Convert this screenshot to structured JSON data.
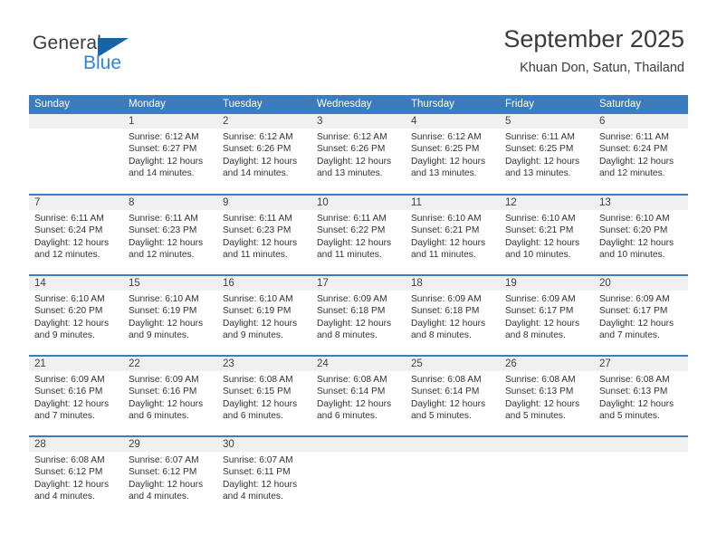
{
  "brand": {
    "name_top": "General",
    "name_bottom": "Blue",
    "accent_color": "#1565a8",
    "blue_text_color": "#2f86d8"
  },
  "header": {
    "title": "September 2025",
    "subtitle": "Khuan Don, Satun, Thailand"
  },
  "theme": {
    "header_row_bg": "#3a7cbe",
    "daynum_bg": "#f0f0f0",
    "text_color": "#333333"
  },
  "weekdays": [
    "Sunday",
    "Monday",
    "Tuesday",
    "Wednesday",
    "Thursday",
    "Friday",
    "Saturday"
  ],
  "labels": {
    "sunrise_prefix": "Sunrise: ",
    "sunset_prefix": "Sunset: ",
    "daylight_prefix": "Daylight: "
  },
  "weeks": [
    [
      {
        "day": "",
        "sunrise": "",
        "sunset": "",
        "daylight_line1": "",
        "daylight_line2": ""
      },
      {
        "day": "1",
        "sunrise": "Sunrise: 6:12 AM",
        "sunset": "Sunset: 6:27 PM",
        "daylight_line1": "Daylight: 12 hours",
        "daylight_line2": "and 14 minutes."
      },
      {
        "day": "2",
        "sunrise": "Sunrise: 6:12 AM",
        "sunset": "Sunset: 6:26 PM",
        "daylight_line1": "Daylight: 12 hours",
        "daylight_line2": "and 14 minutes."
      },
      {
        "day": "3",
        "sunrise": "Sunrise: 6:12 AM",
        "sunset": "Sunset: 6:26 PM",
        "daylight_line1": "Daylight: 12 hours",
        "daylight_line2": "and 13 minutes."
      },
      {
        "day": "4",
        "sunrise": "Sunrise: 6:12 AM",
        "sunset": "Sunset: 6:25 PM",
        "daylight_line1": "Daylight: 12 hours",
        "daylight_line2": "and 13 minutes."
      },
      {
        "day": "5",
        "sunrise": "Sunrise: 6:11 AM",
        "sunset": "Sunset: 6:25 PM",
        "daylight_line1": "Daylight: 12 hours",
        "daylight_line2": "and 13 minutes."
      },
      {
        "day": "6",
        "sunrise": "Sunrise: 6:11 AM",
        "sunset": "Sunset: 6:24 PM",
        "daylight_line1": "Daylight: 12 hours",
        "daylight_line2": "and 12 minutes."
      }
    ],
    [
      {
        "day": "7",
        "sunrise": "Sunrise: 6:11 AM",
        "sunset": "Sunset: 6:24 PM",
        "daylight_line1": "Daylight: 12 hours",
        "daylight_line2": "and 12 minutes."
      },
      {
        "day": "8",
        "sunrise": "Sunrise: 6:11 AM",
        "sunset": "Sunset: 6:23 PM",
        "daylight_line1": "Daylight: 12 hours",
        "daylight_line2": "and 12 minutes."
      },
      {
        "day": "9",
        "sunrise": "Sunrise: 6:11 AM",
        "sunset": "Sunset: 6:23 PM",
        "daylight_line1": "Daylight: 12 hours",
        "daylight_line2": "and 11 minutes."
      },
      {
        "day": "10",
        "sunrise": "Sunrise: 6:11 AM",
        "sunset": "Sunset: 6:22 PM",
        "daylight_line1": "Daylight: 12 hours",
        "daylight_line2": "and 11 minutes."
      },
      {
        "day": "11",
        "sunrise": "Sunrise: 6:10 AM",
        "sunset": "Sunset: 6:21 PM",
        "daylight_line1": "Daylight: 12 hours",
        "daylight_line2": "and 11 minutes."
      },
      {
        "day": "12",
        "sunrise": "Sunrise: 6:10 AM",
        "sunset": "Sunset: 6:21 PM",
        "daylight_line1": "Daylight: 12 hours",
        "daylight_line2": "and 10 minutes."
      },
      {
        "day": "13",
        "sunrise": "Sunrise: 6:10 AM",
        "sunset": "Sunset: 6:20 PM",
        "daylight_line1": "Daylight: 12 hours",
        "daylight_line2": "and 10 minutes."
      }
    ],
    [
      {
        "day": "14",
        "sunrise": "Sunrise: 6:10 AM",
        "sunset": "Sunset: 6:20 PM",
        "daylight_line1": "Daylight: 12 hours",
        "daylight_line2": "and 9 minutes."
      },
      {
        "day": "15",
        "sunrise": "Sunrise: 6:10 AM",
        "sunset": "Sunset: 6:19 PM",
        "daylight_line1": "Daylight: 12 hours",
        "daylight_line2": "and 9 minutes."
      },
      {
        "day": "16",
        "sunrise": "Sunrise: 6:10 AM",
        "sunset": "Sunset: 6:19 PM",
        "daylight_line1": "Daylight: 12 hours",
        "daylight_line2": "and 9 minutes."
      },
      {
        "day": "17",
        "sunrise": "Sunrise: 6:09 AM",
        "sunset": "Sunset: 6:18 PM",
        "daylight_line1": "Daylight: 12 hours",
        "daylight_line2": "and 8 minutes."
      },
      {
        "day": "18",
        "sunrise": "Sunrise: 6:09 AM",
        "sunset": "Sunset: 6:18 PM",
        "daylight_line1": "Daylight: 12 hours",
        "daylight_line2": "and 8 minutes."
      },
      {
        "day": "19",
        "sunrise": "Sunrise: 6:09 AM",
        "sunset": "Sunset: 6:17 PM",
        "daylight_line1": "Daylight: 12 hours",
        "daylight_line2": "and 8 minutes."
      },
      {
        "day": "20",
        "sunrise": "Sunrise: 6:09 AM",
        "sunset": "Sunset: 6:17 PM",
        "daylight_line1": "Daylight: 12 hours",
        "daylight_line2": "and 7 minutes."
      }
    ],
    [
      {
        "day": "21",
        "sunrise": "Sunrise: 6:09 AM",
        "sunset": "Sunset: 6:16 PM",
        "daylight_line1": "Daylight: 12 hours",
        "daylight_line2": "and 7 minutes."
      },
      {
        "day": "22",
        "sunrise": "Sunrise: 6:09 AM",
        "sunset": "Sunset: 6:16 PM",
        "daylight_line1": "Daylight: 12 hours",
        "daylight_line2": "and 6 minutes."
      },
      {
        "day": "23",
        "sunrise": "Sunrise: 6:08 AM",
        "sunset": "Sunset: 6:15 PM",
        "daylight_line1": "Daylight: 12 hours",
        "daylight_line2": "and 6 minutes."
      },
      {
        "day": "24",
        "sunrise": "Sunrise: 6:08 AM",
        "sunset": "Sunset: 6:14 PM",
        "daylight_line1": "Daylight: 12 hours",
        "daylight_line2": "and 6 minutes."
      },
      {
        "day": "25",
        "sunrise": "Sunrise: 6:08 AM",
        "sunset": "Sunset: 6:14 PM",
        "daylight_line1": "Daylight: 12 hours",
        "daylight_line2": "and 5 minutes."
      },
      {
        "day": "26",
        "sunrise": "Sunrise: 6:08 AM",
        "sunset": "Sunset: 6:13 PM",
        "daylight_line1": "Daylight: 12 hours",
        "daylight_line2": "and 5 minutes."
      },
      {
        "day": "27",
        "sunrise": "Sunrise: 6:08 AM",
        "sunset": "Sunset: 6:13 PM",
        "daylight_line1": "Daylight: 12 hours",
        "daylight_line2": "and 5 minutes."
      }
    ],
    [
      {
        "day": "28",
        "sunrise": "Sunrise: 6:08 AM",
        "sunset": "Sunset: 6:12 PM",
        "daylight_line1": "Daylight: 12 hours",
        "daylight_line2": "and 4 minutes."
      },
      {
        "day": "29",
        "sunrise": "Sunrise: 6:07 AM",
        "sunset": "Sunset: 6:12 PM",
        "daylight_line1": "Daylight: 12 hours",
        "daylight_line2": "and 4 minutes."
      },
      {
        "day": "30",
        "sunrise": "Sunrise: 6:07 AM",
        "sunset": "Sunset: 6:11 PM",
        "daylight_line1": "Daylight: 12 hours",
        "daylight_line2": "and 4 minutes."
      },
      {
        "day": "",
        "sunrise": "",
        "sunset": "",
        "daylight_line1": "",
        "daylight_line2": ""
      },
      {
        "day": "",
        "sunrise": "",
        "sunset": "",
        "daylight_line1": "",
        "daylight_line2": ""
      },
      {
        "day": "",
        "sunrise": "",
        "sunset": "",
        "daylight_line1": "",
        "daylight_line2": ""
      },
      {
        "day": "",
        "sunrise": "",
        "sunset": "",
        "daylight_line1": "",
        "daylight_line2": ""
      }
    ]
  ]
}
